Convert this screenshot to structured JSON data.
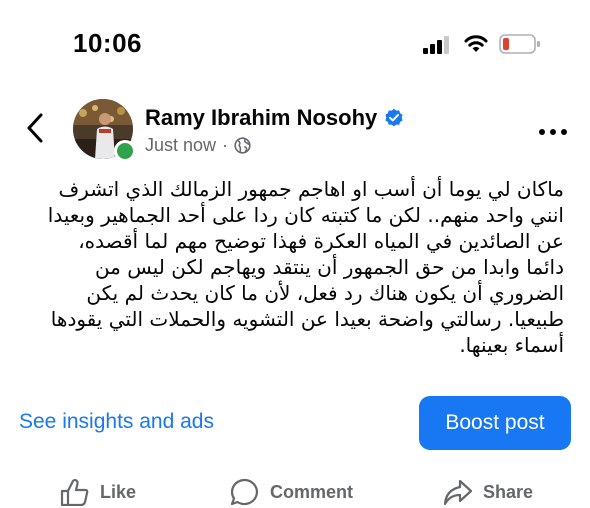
{
  "status_bar": {
    "time": "10:06"
  },
  "post": {
    "author": "Ramy Ibrahim Nosohy",
    "timestamp": "Just now",
    "separator": "·",
    "lines": [
      "ماكان لي يوما أن أسب او اهاجم جمهور الزمالك الذي اتشرف",
      "انني واحد منهم.. لكن ما كتبته كان ردا على أحد الجماهير وبعيدا",
      "عن الصائدين في المياه العكرة فهذا توضيح مهم لما أقصده،",
      "دائما وابدا من حق الجمهور أن ينتقد ويهاجم لكن ليس من",
      "الضروري أن يكون هناك رد فعل، لأن ما كان يحدث لم يكن",
      "طبيعيا. رسالتي واضحة بعيدا عن التشويه والحملات التي يقودها",
      "أسماء بعينها."
    ]
  },
  "actions_bar": {
    "insights_label": "See insights and ads",
    "boost_label": "Boost post",
    "like_label": "Like",
    "comment_label": "Comment",
    "share_label": "Share"
  },
  "colors": {
    "accent": "#1877f2",
    "online": "#31a24c",
    "verified": "#1877f2",
    "battery_low": "#e0412f"
  },
  "icons": [
    "signal-icon",
    "wifi-icon",
    "battery-icon",
    "back-chevron-icon",
    "verified-badge-icon",
    "globe-icon",
    "more-icon",
    "like-icon",
    "comment-icon",
    "share-icon"
  ]
}
